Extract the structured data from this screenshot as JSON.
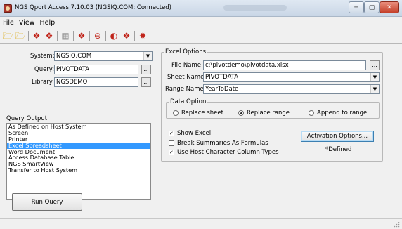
{
  "window": {
    "title": "NGS Qport Access 7.10.03 (NGSIQ.COM: Connected)",
    "min_glyph": "─",
    "max_glyph": "▢",
    "close_glyph": "✕"
  },
  "menu": {
    "items": [
      "File",
      "View",
      "Help"
    ]
  },
  "toolbar": {
    "icons": [
      "open-folder-icon",
      "open-folder-icon",
      "red-action-icon",
      "red-action-icon",
      "grid-icon",
      "red-action-icon",
      "red-minus-icon",
      "half-circle-icon",
      "red-action-icon",
      "red-star-icon"
    ]
  },
  "connection": {
    "system_label": "System:",
    "system_value": "NGSIQ.COM",
    "query_label": "Query:",
    "query_value": "PIVOTDATA",
    "library_label": "Library:",
    "library_value": "NGSDEMO",
    "browse_label": "..."
  },
  "query_output": {
    "label": "Query Output",
    "items": [
      "As Defined on Host System",
      "Screen",
      "Printer",
      "Excel Spreadsheet",
      "Word Document",
      "Access Database Table",
      "NGS SmartView",
      "Transfer to Host System"
    ],
    "selected_index": 3
  },
  "run_query": {
    "label": "Run Query"
  },
  "excel_options": {
    "title": "Excel Options",
    "file_name_label": "File Name:",
    "file_name_value": "c:\\pivotdemo\\pivotdata.xlsx",
    "sheet_name_label": "Sheet Name:",
    "sheet_name_value": "PIVOTDATA",
    "range_name_label": "Range Name:",
    "range_name_value": "YearToDate",
    "browse_label": "...",
    "data_option": {
      "title": "Data Option",
      "replace_sheet": "Replace sheet",
      "replace_range": "Replace range",
      "append_to_range": "Append to range",
      "selected": "replace_range"
    },
    "show_excel": {
      "label": "Show Excel",
      "checked": true
    },
    "break_summaries": {
      "label": "Break Summaries As Formulas",
      "checked": false
    },
    "use_host_types": {
      "label": "Use Host Character Column Types",
      "checked": true
    },
    "activation_button": "Activation Options...",
    "defined_note": "*Defined",
    "check_glyph": "✓"
  },
  "colors": {
    "selection": "#3399ff",
    "close_button": "#c4402a",
    "panel_background": "#f0f0f0"
  }
}
